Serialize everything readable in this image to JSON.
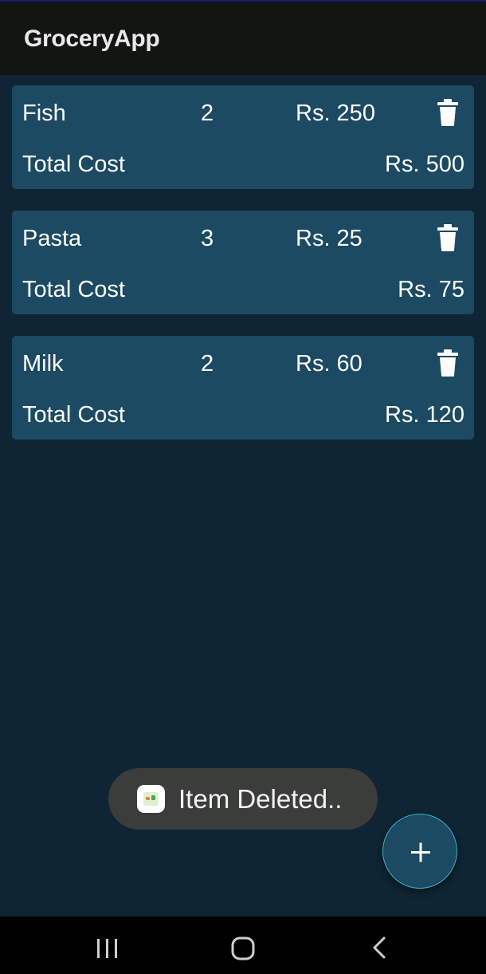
{
  "app": {
    "title": "GroceryApp"
  },
  "items": [
    {
      "name": "Fish",
      "quantity": "2",
      "price": "Rs. 250",
      "total_label": "Total Cost",
      "total": "Rs. 500",
      "delete_icon": "trash-icon"
    },
    {
      "name": "Pasta",
      "quantity": "3",
      "price": "Rs. 25",
      "total_label": "Total Cost",
      "total": "Rs. 75",
      "delete_icon": "trash-icon"
    },
    {
      "name": "Milk",
      "quantity": "2",
      "price": "Rs. 60",
      "total_label": "Total Cost",
      "total": "Rs. 120",
      "delete_icon": "trash-icon"
    }
  ],
  "toast": {
    "text": "Item Deleted..",
    "icon": "app-icon"
  },
  "fab": {
    "icon": "plus-icon"
  },
  "navigation": {
    "recents_icon": "recents-icon",
    "home_icon": "home-icon",
    "back_icon": "back-icon"
  },
  "colors": {
    "background": "#0f2533",
    "app_bar": "#121512",
    "card": "#1c4a62",
    "toast": "#3a3d3a",
    "text": "#ffffff"
  }
}
